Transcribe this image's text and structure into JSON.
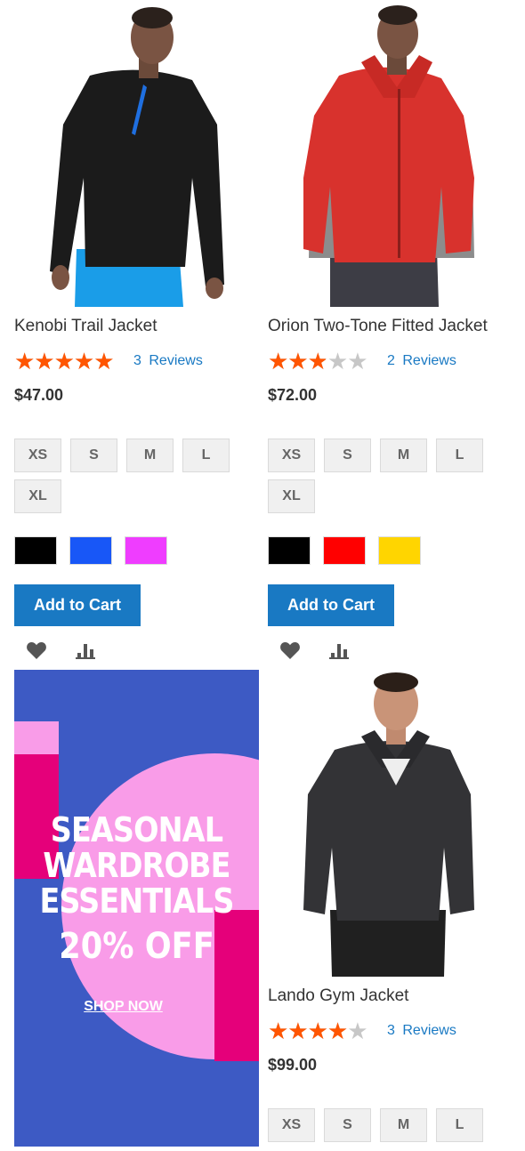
{
  "products": [
    {
      "name": "Kenobi Trail Jacket",
      "rating_fraction": 0.9,
      "reviews_count": "3",
      "reviews_label": "Reviews",
      "price": "$47.00",
      "sizes": [
        "XS",
        "S",
        "M",
        "L",
        "XL"
      ],
      "colors": [
        "#000000",
        "#1857f7",
        "#ef3dff"
      ],
      "add_to_cart": "Add to Cart"
    },
    {
      "name": "Orion Two-Tone Fitted Jacket",
      "rating_fraction": 0.5,
      "reviews_count": "2",
      "reviews_label": "Reviews",
      "price": "$72.00",
      "sizes": [
        "XS",
        "S",
        "M",
        "L",
        "XL"
      ],
      "colors": [
        "#000000",
        "#ff0000",
        "#ffd500"
      ],
      "add_to_cart": "Add to Cart"
    },
    {
      "name": "Lando Gym Jacket",
      "rating_fraction": 0.7,
      "reviews_count": "3",
      "reviews_label": "Reviews",
      "price": "$99.00",
      "sizes": [
        "XS",
        "S",
        "M",
        "L"
      ]
    }
  ],
  "banner": {
    "line1": "SEASONAL",
    "line2": "WARDROBE",
    "line3": "ESSENTIALS",
    "offer": "20% OFF",
    "cta": "SHOP NOW"
  },
  "icons": {
    "wishlist": "heart-icon",
    "compare": "bar-chart-icon"
  },
  "colors": {
    "accent": "#1979c3",
    "star": "#ff5501",
    "banner_blue": "#3d5ac4",
    "banner_pink": "#f99ce8",
    "banner_magenta": "#e5007a"
  }
}
